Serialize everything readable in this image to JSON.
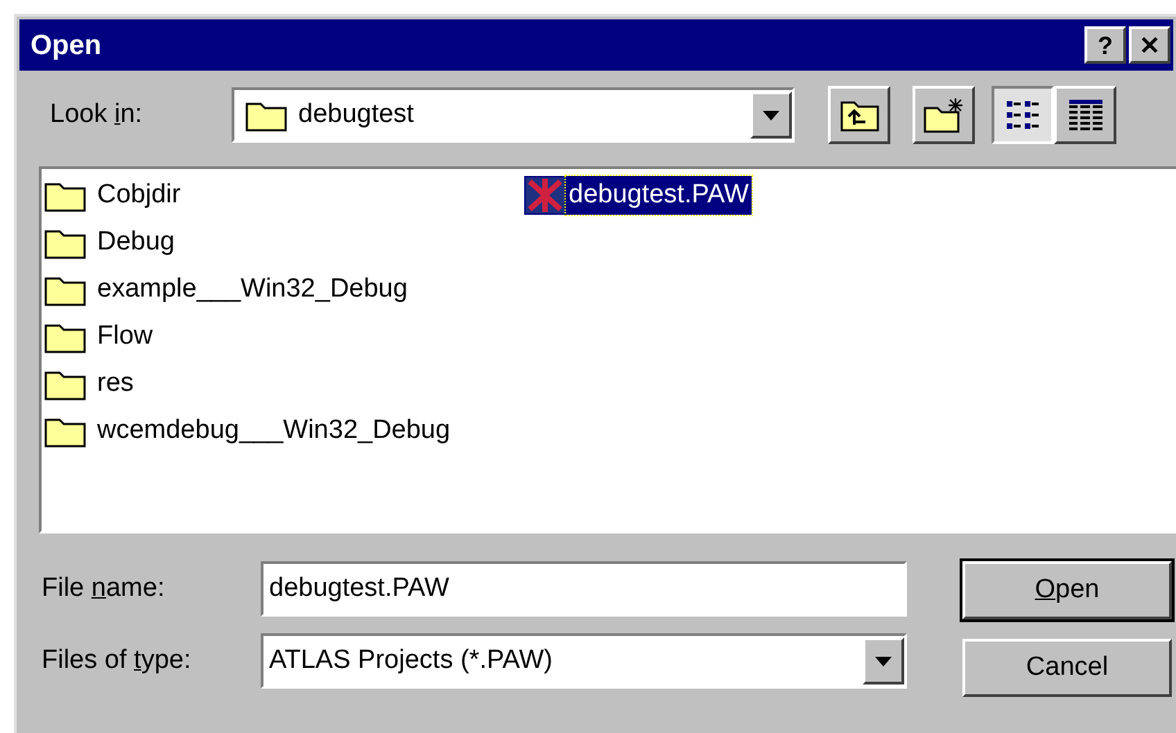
{
  "window": {
    "title": "Open",
    "help_button": "?",
    "close_button": "✕"
  },
  "look_in": {
    "label": {
      "before": "Look ",
      "key": "i",
      "after": "n:"
    },
    "value": "debugtest"
  },
  "toolbar": [
    {
      "kind": "up",
      "selected": false
    },
    {
      "kind": "new_folder",
      "selected": false
    },
    {
      "kind": "list",
      "selected": true
    },
    {
      "kind": "details",
      "selected": false
    }
  ],
  "files": [
    {
      "name": "Cobjdir",
      "kind": "folder",
      "selected": false
    },
    {
      "name": "Debug",
      "kind": "folder",
      "selected": false
    },
    {
      "name": "example___Win32_Debug",
      "kind": "folder",
      "selected": false
    },
    {
      "name": "Flow",
      "kind": "folder",
      "selected": false
    },
    {
      "name": "res",
      "kind": "folder",
      "selected": false
    },
    {
      "name": "wcemdebug___Win32_Debug",
      "kind": "folder",
      "selected": false
    },
    {
      "name": "debugtest.PAW",
      "kind": "project",
      "selected": true
    }
  ],
  "file_name": {
    "label": {
      "before": "File ",
      "key": "n",
      "after": "ame:"
    },
    "value": "debugtest.PAW"
  },
  "file_type": {
    "label": {
      "before": "Files of ",
      "key": "t",
      "after": "ype:"
    },
    "value": "ATLAS Projects (*.PAW)"
  },
  "buttons": [
    {
      "label": {
        "key": "O",
        "after": "pen"
      },
      "default": true
    },
    {
      "label": {
        "after": "Cancel"
      },
      "default": false
    }
  ]
}
